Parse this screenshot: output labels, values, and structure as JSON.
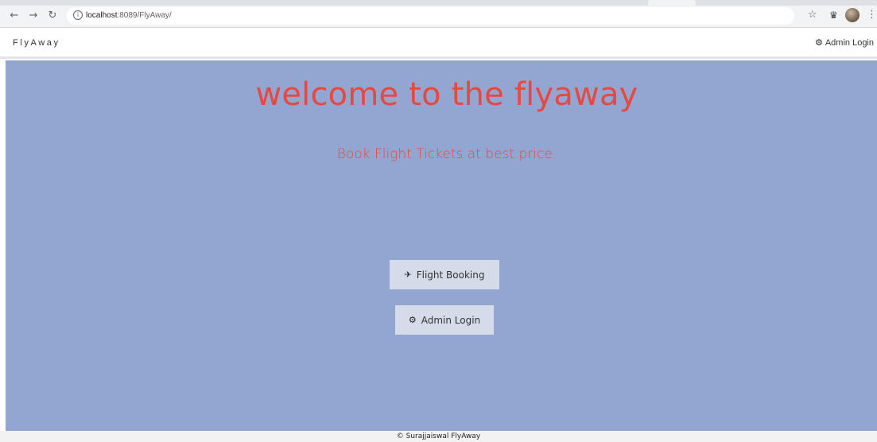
{
  "browser": {
    "url_host": "localhost",
    "url_rest": ":8089/FlyAway/",
    "back_icon": "arrow-left",
    "forward_icon": "arrow-right",
    "reload_icon": "reload",
    "info_icon": "info-circle"
  },
  "navbar": {
    "brand": "FlyAway",
    "admin_label": "Admin Login"
  },
  "hero": {
    "title": "welcome to the flyaway",
    "subtitle": "Book Flight Tickets at best price.",
    "background": "#93a6d2",
    "accent": "#e8483f"
  },
  "buttons": {
    "flight_booking": "Flight Booking",
    "admin_login": "Admin Login"
  },
  "footer": {
    "text": "© Surajjaiswal FlyAway"
  }
}
